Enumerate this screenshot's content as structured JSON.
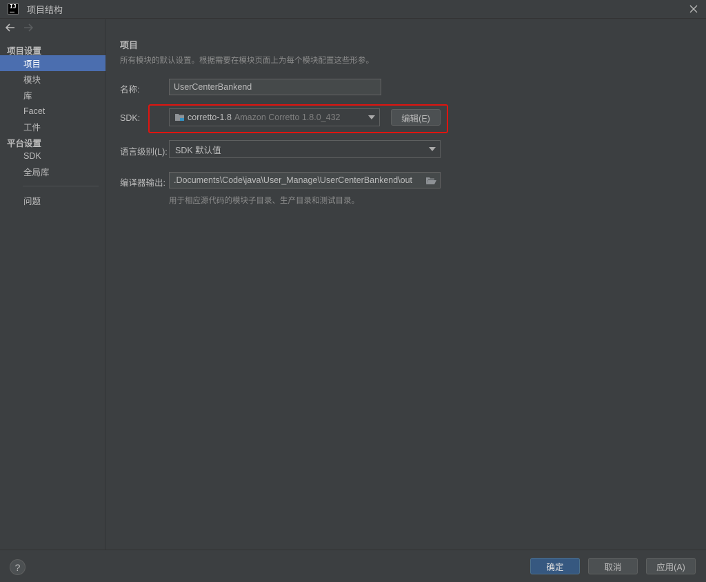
{
  "window": {
    "title": "项目结构",
    "close_icon": "close-icon"
  },
  "sidebar": {
    "back_icon": "arrow-left-icon",
    "forward_icon": "arrow-right-icon",
    "section_project_settings": "项目设置",
    "section_platform_settings": "平台设置",
    "items": [
      {
        "label": "项目",
        "selected": true
      },
      {
        "label": "模块"
      },
      {
        "label": "库"
      },
      {
        "label": "Facet"
      },
      {
        "label": "工件"
      },
      {
        "label": "SDK"
      },
      {
        "label": "全局库"
      },
      {
        "label": "问题"
      }
    ]
  },
  "main": {
    "title": "项目",
    "description": "所有模块的默认设置。根据需要在模块页面上为每个模块配置这些形参。",
    "name_label": "名称:",
    "name_value": "UserCenterBankend",
    "sdk_label": "SDK:",
    "sdk_value": "corretto-1.8",
    "sdk_detail": "Amazon Corretto 1.8.0_432",
    "edit_button": "编辑(E)",
    "language_level_label": "语言级别(L):",
    "language_level_value": "SDK 默认值",
    "compiler_output_label": "编译器输出:",
    "compiler_output_value": ".Documents\\Code\\java\\User_Manage\\UserCenterBankend\\out",
    "compiler_output_hint": "用于相应源代码的模块子目录、生产目录和测试目录。"
  },
  "footer": {
    "help_label": "?",
    "ok_button": "确定",
    "cancel_button": "取消",
    "apply_button": "应用(A)"
  },
  "colors": {
    "background": "#3c3f41",
    "selection": "#4b6eaf",
    "primary_button": "#365880",
    "highlight_box": "#e0140f"
  }
}
